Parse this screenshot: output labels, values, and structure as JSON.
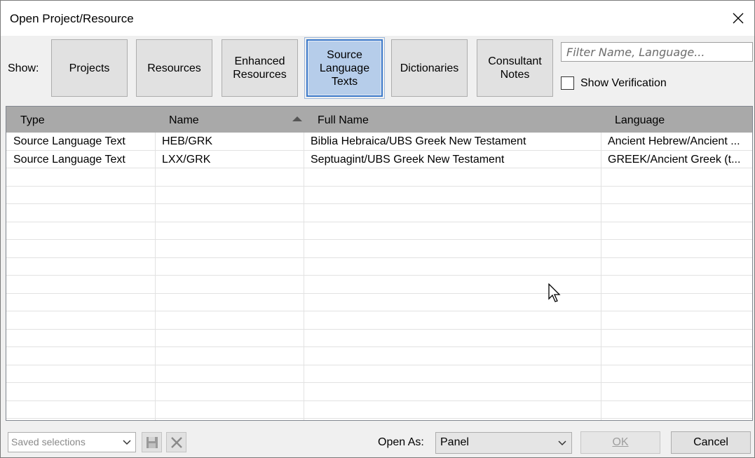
{
  "window": {
    "title": "Open Project/Resource"
  },
  "show_label": "Show:",
  "filters": [
    {
      "label": "Projects",
      "active": false
    },
    {
      "label": "Resources",
      "active": false
    },
    {
      "label": "Enhanced\nResources",
      "active": false
    },
    {
      "label": "Source\nLanguage\nTexts",
      "active": true
    },
    {
      "label": "Dictionaries",
      "active": false
    },
    {
      "label": "Consultant\nNotes",
      "active": false
    }
  ],
  "search": {
    "placeholder": "Filter Name, Language...",
    "value": ""
  },
  "show_verification": {
    "label": "Show Verification",
    "checked": false
  },
  "table": {
    "columns": [
      "Type",
      "Name",
      "Full Name",
      "Language"
    ],
    "sorted_column": "Name",
    "rows": [
      [
        "Source Language Text",
        "HEB/GRK",
        "Biblia Hebraica/UBS Greek New Testament",
        "Ancient Hebrew/Ancient ..."
      ],
      [
        "Source Language Text",
        "LXX/GRK",
        "Septuagint/UBS Greek New Testament",
        "GREEK/Ancient Greek (t..."
      ]
    ]
  },
  "footer": {
    "saved_selections_placeholder": "Saved selections",
    "open_as_label": "Open As:",
    "open_as_value": "Panel",
    "ok_label": "OK",
    "cancel_label": "Cancel"
  },
  "colors": {
    "active_button_bg": "#b6cdea",
    "active_button_border": "#3a78c9",
    "header_bg": "#a9a9a9"
  }
}
